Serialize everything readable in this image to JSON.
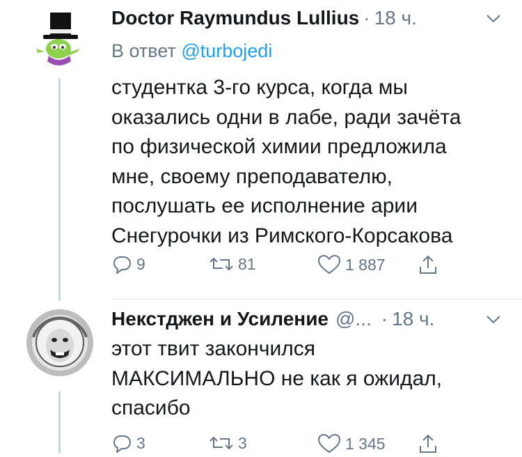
{
  "tweets": [
    {
      "display_name": "Doctor Raymundus Lullius",
      "handle": "",
      "separator": "·",
      "time": "18 ч.",
      "reply_prefix": "В ответ",
      "reply_mention": "@turbojedi",
      "body_lines": [
        "студентка 3-го курса, когда мы",
        "оказались одни в лабе, ради зачёта",
        "по физической химии предложила",
        "мне, своему преподавателю,",
        "послушать ее исполнение арии",
        "Снегурочки из Римского-Корсакова"
      ],
      "replies": "9",
      "retweets": "81",
      "likes": "1 887",
      "avatar_icon": "top-hat-character-icon"
    },
    {
      "display_name": "Некстджен и Усиление",
      "handle": "@...",
      "separator": "·",
      "time": "18 ч.",
      "body_lines": [
        "этот твит закончился",
        "МАКСИМАЛЬНО не как я ожидал,",
        "спасибо"
      ],
      "replies": "3",
      "retweets": "3",
      "likes": "1 345",
      "avatar_icon": "cosmonaut-portrait-icon"
    }
  ],
  "colors": {
    "text": "#14171a",
    "muted": "#657786",
    "link": "#1da1f2",
    "thread_line": "#ccd6dd",
    "divider": "#e1e8ed"
  }
}
